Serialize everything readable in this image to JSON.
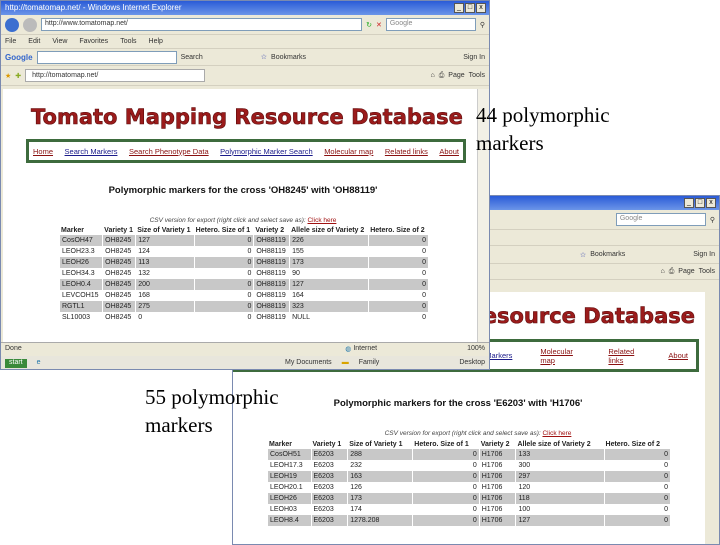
{
  "window1": {
    "title": "http://tomatomap.net/ - Windows Internet Explorer",
    "address": "http://www.tomatomap.net/",
    "search_placeholder": "Google",
    "menu": [
      "File",
      "Edit",
      "View",
      "Favorites",
      "Tools",
      "Help"
    ],
    "google_toolbar": {
      "logo": "Google",
      "search": "Search",
      "bookmarks": "Bookmarks",
      "signin": "Sign In"
    },
    "tab": "http://tomatomap.net/",
    "cmdbar": {
      "page": "Page",
      "tools": "Tools"
    },
    "site_title": "Tomato Mapping Resource Database",
    "nav": [
      "Home",
      "Search Markers",
      "Search Phenotype Data",
      "Polymorphic Marker Search",
      "Molecular map",
      "Related links",
      "About"
    ],
    "heading": "Polymorphic markers for the cross 'OH8245' with 'OH88119'",
    "csv_text": "CSV version for export (right click and select save as):",
    "csv_link": "Click here",
    "columns": [
      "Marker",
      "Variety 1",
      "Size of Variety 1",
      "Hetero. Size of 1",
      "Variety 2",
      "Allele size of Variety 2",
      "Hetero. Size of 2"
    ],
    "rows": [
      [
        "CosOH47",
        "OH8245",
        "127",
        "0",
        "OH88119",
        "226",
        "0"
      ],
      [
        "LEOH23.3",
        "OH8245",
        "124",
        "0",
        "OH88119",
        "155",
        "0"
      ],
      [
        "LEOH26",
        "OH8245",
        "113",
        "0",
        "OH88119",
        "173",
        "0"
      ],
      [
        "LEOH34.3",
        "OH8245",
        "132",
        "0",
        "OH88119",
        "90",
        "0"
      ],
      [
        "LEOH0.4",
        "OH8245",
        "200",
        "0",
        "OH88119",
        "127",
        "0"
      ],
      [
        "LEVCOH15",
        "OH8245",
        "168",
        "0",
        "OH88119",
        "164",
        "0"
      ],
      [
        "RGTL1",
        "OH8245",
        "275",
        "0",
        "OH88119",
        "323",
        "0"
      ],
      [
        "SL10003",
        "OH8245",
        "0",
        "0",
        "OH88119",
        "NULL",
        "0"
      ]
    ],
    "status": "Done",
    "zone": "Internet",
    "zoom": "100%",
    "taskbar": {
      "start": "start",
      "docs": "My Documents",
      "folder": "Family",
      "desktop": "Desktop"
    }
  },
  "window2": {
    "address": "Google",
    "google_toolbar": {
      "bookmarks": "Bookmarks",
      "signin": "Sign In"
    },
    "cmdbar": {
      "page": "Page",
      "tools": "Tools"
    },
    "site_title": "Tomato Mapping Resource Database",
    "nav": [
      "Markers",
      "Molecular map",
      "Related links",
      "About"
    ],
    "heading": "Polymorphic markers for the cross 'E6203' with 'H1706'",
    "csv_text": "CSV version for export (right click and select save as):",
    "csv_link": "Click here",
    "columns": [
      "Marker",
      "Variety 1",
      "Size of Variety 1",
      "Hetero. Size of 1",
      "Variety 2",
      "Allele size of Variety 2",
      "Hetero. Size of 2"
    ],
    "rows": [
      [
        "CosOH51",
        "E6203",
        "288",
        "0",
        "H1706",
        "133",
        "0"
      ],
      [
        "LEOH17.3",
        "E6203",
        "232",
        "0",
        "H1706",
        "300",
        "0"
      ],
      [
        "LEOH19",
        "E6203",
        "163",
        "0",
        "H1706",
        "297",
        "0"
      ],
      [
        "LEOH20.1",
        "E6203",
        "126",
        "0",
        "H1706",
        "120",
        "0"
      ],
      [
        "LEOH26",
        "E6203",
        "173",
        "0",
        "H1706",
        "118",
        "0"
      ],
      [
        "LEOH03",
        "E6203",
        "174",
        "0",
        "H1706",
        "100",
        "0"
      ],
      [
        "LEOH8.4",
        "E6203",
        "1278.208",
        "0",
        "H1706",
        "127",
        "0"
      ]
    ]
  },
  "captions": {
    "top": "44 polymorphic markers",
    "bottom": "55 polymorphic markers"
  }
}
